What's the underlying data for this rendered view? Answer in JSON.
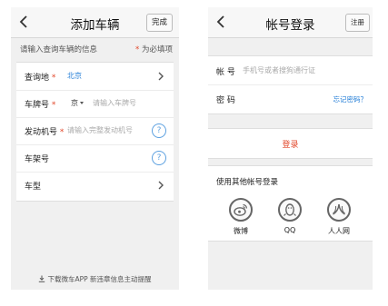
{
  "add_vehicle": {
    "title": "添加车辆",
    "done_label": "完成",
    "hint": "请输入查询车辆的信息",
    "required_mark": "*",
    "required_note": "为必填项",
    "fields": [
      {
        "label": "查询地",
        "required": true,
        "value": "北京"
      },
      {
        "label": "车牌号",
        "required": true,
        "prefix": "京",
        "placeholder": "请输入车牌号"
      },
      {
        "label": "发动机号",
        "required": true,
        "placeholder": "请输入完整发动机号"
      },
      {
        "label": "车架号",
        "required": false
      },
      {
        "label": "车型",
        "required": false
      }
    ],
    "download_tip": "下载微车APP 新违章信息主动提醒"
  },
  "login": {
    "title": "帐号登录",
    "register_label": "注册",
    "account_label": "帐  号",
    "account_placeholder": "手机号或者搜狗通行证",
    "password_label": "密  码",
    "forgot_label": "忘记密码？",
    "login_label": "登录",
    "other_title": "使用其他帐号登录",
    "socials": [
      {
        "name": "微博",
        "icon": "weibo-icon"
      },
      {
        "name": "QQ",
        "icon": "qq-penguin-icon"
      },
      {
        "name": "人人网",
        "icon": "renren-icon"
      }
    ]
  },
  "colors": {
    "accent_red": "#e2472a",
    "link_blue": "#1f7bd6",
    "background": "#f0f0f0"
  }
}
